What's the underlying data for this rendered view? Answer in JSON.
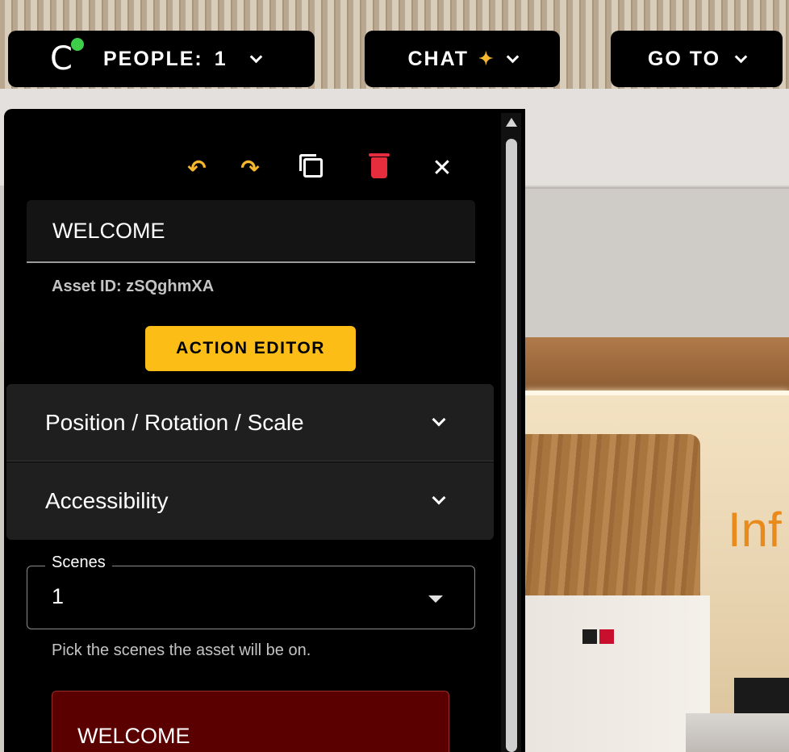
{
  "topbar": {
    "logo_letter": "C",
    "people_label": "PEOPLE:",
    "people_count": "1",
    "chat_label": "CHAT",
    "goto_label": "GO TO"
  },
  "panel": {
    "toolbar": {
      "undo_glyph": "↶",
      "redo_glyph": "↷",
      "close_glyph": "✕"
    },
    "asset_name": "WELCOME",
    "asset_id": "Asset ID: zSQghmXA",
    "action_editor_label": "ACTION EDITOR",
    "accordions": [
      {
        "label": "Position / Rotation / Scale"
      },
      {
        "label": "Accessibility"
      }
    ],
    "scenes": {
      "legend": "Scenes",
      "value": "1",
      "helper": "Pick the scenes the asset will be on."
    },
    "preview_text": "WELCOME"
  },
  "scene": {
    "sign_text": "Inf"
  },
  "colors": {
    "accent_yellow": "#fbbd16",
    "delete_red": "#e62d3d",
    "online_green": "#3ecf4a",
    "preview_bg": "#5a0000"
  }
}
